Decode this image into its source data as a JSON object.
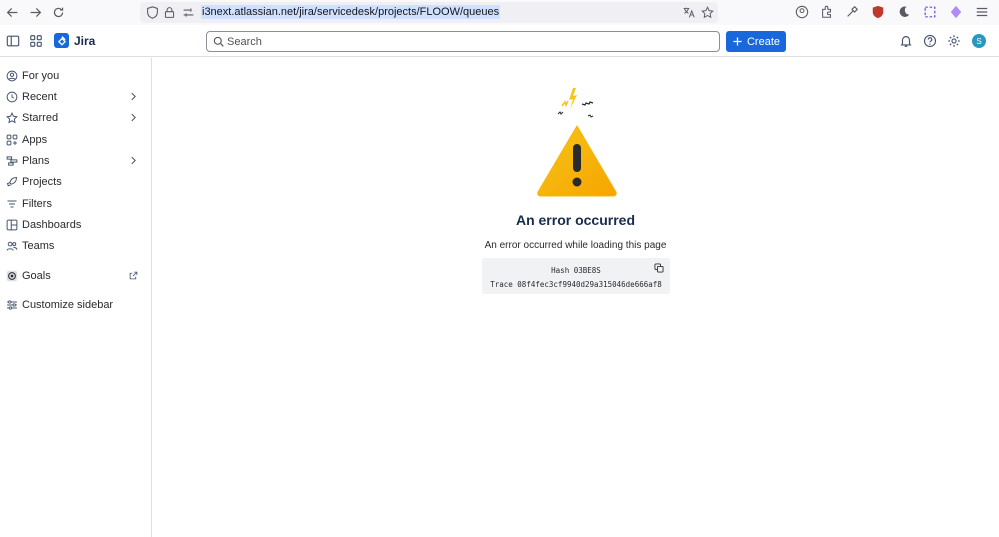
{
  "browser": {
    "url": "i3next.atlassian.net/jira/servicedesk/projects/FLOOW/queues"
  },
  "topnav": {
    "app_name": "Jira",
    "search_placeholder": "Search",
    "create_label": "Create",
    "avatar_initial": "S",
    "accent": "#1868db"
  },
  "sidebar": {
    "items": [
      {
        "label": "For you"
      },
      {
        "label": "Recent"
      },
      {
        "label": "Starred"
      },
      {
        "label": "Apps"
      },
      {
        "label": "Plans"
      },
      {
        "label": "Projects"
      },
      {
        "label": "Filters"
      },
      {
        "label": "Dashboards"
      },
      {
        "label": "Teams"
      },
      {
        "label": "Goals"
      },
      {
        "label": "Customize sidebar"
      }
    ]
  },
  "error": {
    "title": "An error occurred",
    "message": "An error occurred while loading this page",
    "hash_line": "Hash 03BE8S",
    "trace_line": "Trace 08f4fec3cf9940d29a315046de666af8"
  }
}
